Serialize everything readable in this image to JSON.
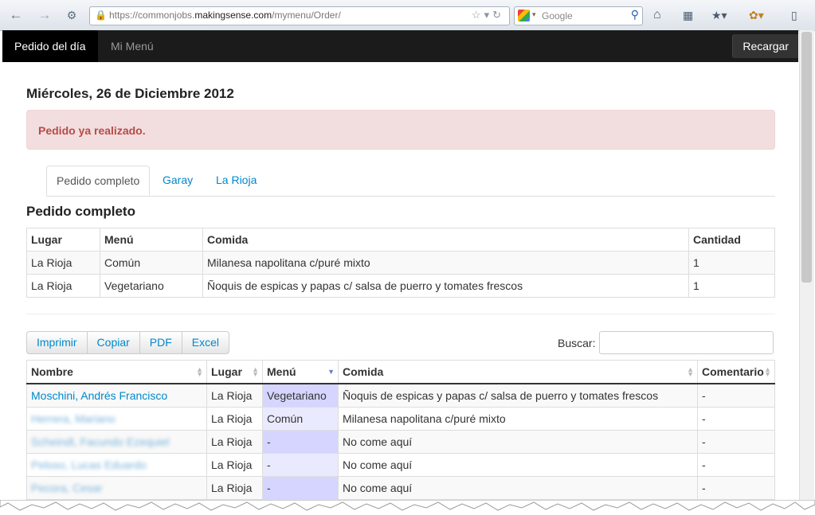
{
  "browser": {
    "url_prefix": "https://commonjobs.",
    "url_domain": "makingsense.com",
    "url_path": "/mymenu/Order/",
    "search_placeholder": "Google",
    "icons": [
      "back-icon",
      "forward-icon",
      "tools-icon",
      "lock-icon",
      "star-icon",
      "reload-icon",
      "home-icon",
      "grid-icon",
      "bookmark-icon",
      "addon-icon",
      "sidebar-icon"
    ]
  },
  "nav": {
    "items": [
      {
        "label": "Pedido del día"
      },
      {
        "label": "Mi Menú"
      }
    ],
    "reload_label": "Recargar"
  },
  "page": {
    "date_title": "Miércoles, 26 de Diciembre 2012",
    "alert": "Pedido ya realizado.",
    "tabs": [
      {
        "label": "Pedido completo"
      },
      {
        "label": "Garay"
      },
      {
        "label": "La Rioja"
      }
    ],
    "section_title": "Pedido completo"
  },
  "summary_table": {
    "headers": [
      "Lugar",
      "Menú",
      "Comida",
      "Cantidad"
    ],
    "rows": [
      [
        "La Rioja",
        "Común",
        "Milanesa napolitana c/puré mixto",
        "1"
      ],
      [
        "La Rioja",
        "Vegetariano",
        "Ñoquis de espicas y papas c/ salsa de puerro y tomates frescos",
        "1"
      ]
    ]
  },
  "toolbar": {
    "buttons": [
      {
        "label": "Imprimir"
      },
      {
        "label": "Copiar"
      },
      {
        "label": "PDF"
      },
      {
        "label": "Excel"
      }
    ],
    "search_label": "Buscar:"
  },
  "detail_table": {
    "headers": [
      "Nombre",
      "Lugar",
      "Menú",
      "Comida",
      "Comentario"
    ],
    "rows": [
      [
        "Moschini, Andrés Francisco",
        "La Rioja",
        "Vegetariano",
        "Ñoquis de espicas y papas c/ salsa de puerro y tomates frescos",
        "-"
      ],
      [
        "Herrera, Mariano",
        "La Rioja",
        "Común",
        "Milanesa napolitana c/puré mixto",
        "-"
      ],
      [
        "Scheindl, Facundo Ezequiel",
        "La Rioja",
        "-",
        "No come aquí",
        "-"
      ],
      [
        "Peloso, Lucas Eduardo",
        "La Rioja",
        "-",
        "No come aquí",
        "-"
      ],
      [
        "Pecora, Cesar",
        "La Rioja",
        "-",
        "No come aquí",
        "-"
      ]
    ]
  },
  "colors": {
    "nav_bg": "#1b1b1b",
    "link": "#0088cc",
    "alert_bg": "#f2dede",
    "alert_text": "#b94a48",
    "sorted_col": "#d5d5ff"
  }
}
